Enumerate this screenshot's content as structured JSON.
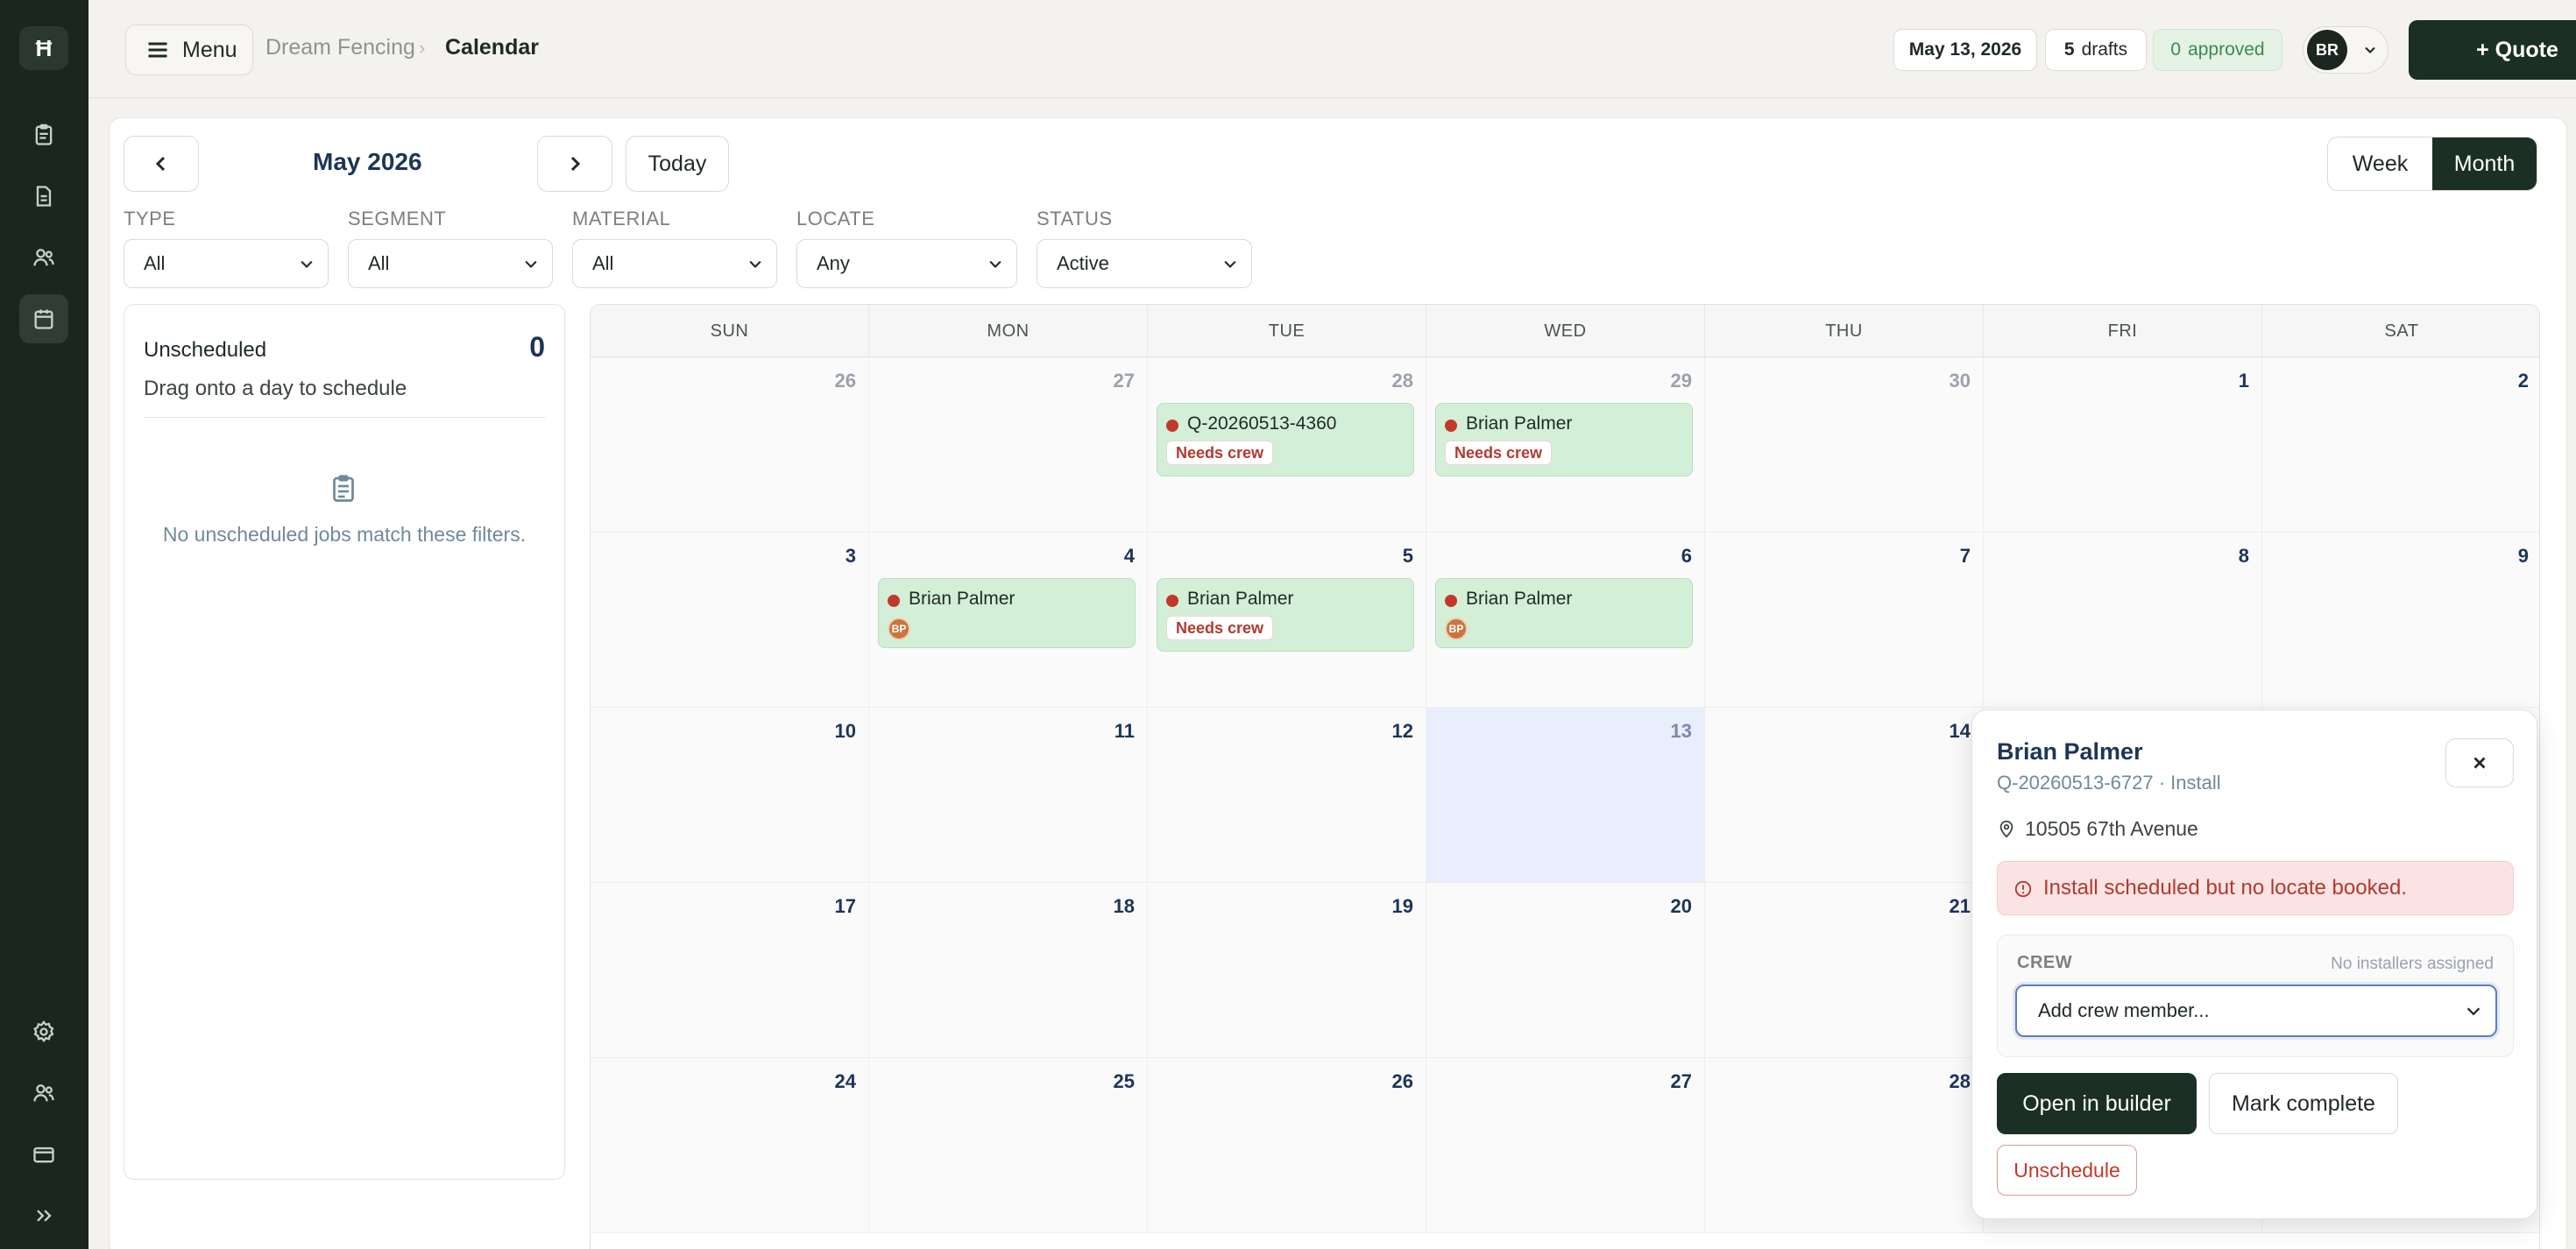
{
  "app": {
    "logo": "Ħ"
  },
  "rail": {
    "items": [
      {
        "name": "quotes-clipboard-icon"
      },
      {
        "name": "documents-icon"
      },
      {
        "name": "customers-users-icon"
      },
      {
        "name": "calendar-icon",
        "active": true
      }
    ],
    "bottom": [
      {
        "name": "settings-gear-icon"
      },
      {
        "name": "team-users-icon"
      },
      {
        "name": "billing-card-icon"
      },
      {
        "name": "expand-chevrons-icon"
      }
    ]
  },
  "topbar": {
    "menu_label": "Menu",
    "breadcrumb": [
      "Dream Fencing",
      "Calendar"
    ],
    "date_pill": "May 13, 2026",
    "drafts_count": "5",
    "drafts_label": "drafts",
    "approved_count": "0",
    "approved_label": "approved",
    "avatar_initials": "BR",
    "quote_button": "+ Quote"
  },
  "calendar_toolbar": {
    "month_title": "May 2026",
    "today_label": "Today",
    "views": [
      "Week",
      "Month"
    ],
    "active_view": "Month"
  },
  "filters": [
    {
      "label": "TYPE",
      "value": "All"
    },
    {
      "label": "SEGMENT",
      "value": "All"
    },
    {
      "label": "MATERIAL",
      "value": "All"
    },
    {
      "label": "LOCATE",
      "value": "Any"
    },
    {
      "label": "STATUS",
      "value": "Active"
    }
  ],
  "unscheduled": {
    "title": "Unscheduled",
    "count": "0",
    "subtitle": "Drag onto a day to schedule",
    "empty_message": "No unscheduled jobs match these filters."
  },
  "weekdays": [
    "SUN",
    "MON",
    "TUE",
    "WED",
    "THU",
    "FRI",
    "SAT"
  ],
  "weeks": [
    [
      "26",
      "27",
      "28",
      "29",
      "30",
      "1",
      "2"
    ],
    [
      "3",
      "4",
      "5",
      "6",
      "7",
      "8",
      "9"
    ],
    [
      "10",
      "11",
      "12",
      "13",
      "14",
      "",
      ""
    ],
    [
      "17",
      "18",
      "19",
      "20",
      "21",
      "",
      ""
    ],
    [
      "24",
      "25",
      "26",
      "27",
      "28",
      "",
      ""
    ]
  ],
  "events": {
    "apr28": {
      "title": "Q-20260513-4360",
      "badge": "Needs crew"
    },
    "apr29": {
      "title": "Brian Palmer",
      "badge": "Needs crew"
    },
    "may4": {
      "title": "Brian Palmer",
      "crew_initials": "BP"
    },
    "may5": {
      "title": "Brian Palmer",
      "badge": "Needs crew"
    },
    "may6": {
      "title": "Brian Palmer",
      "crew_initials": "BP"
    }
  },
  "popover": {
    "name": "Brian Palmer",
    "subtitle": "Q-20260513-6727 · Install",
    "address": "10505 67th Avenue",
    "alert": "Install scheduled but no locate booked.",
    "crew_label": "CREW",
    "crew_status": "No installers assigned",
    "crew_select": "Add crew member...",
    "open_button": "Open in builder",
    "complete_button": "Mark complete",
    "unschedule_button": "Unschedule"
  }
}
